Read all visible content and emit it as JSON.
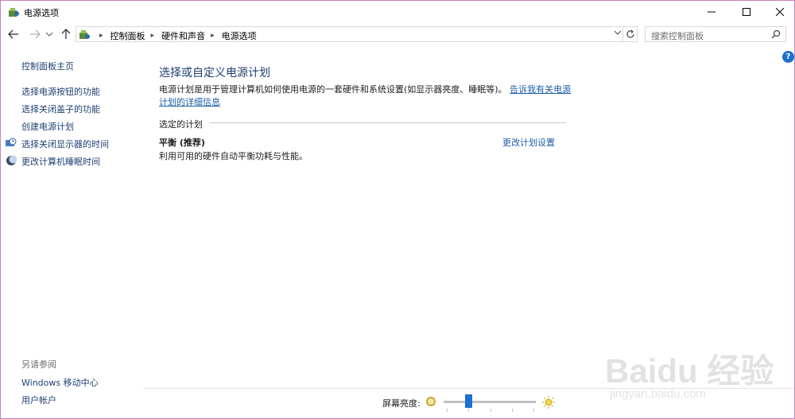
{
  "window": {
    "title": "电源选项"
  },
  "address": {
    "crumbs": [
      "控制面板",
      "硬件和声音",
      "电源选项"
    ],
    "search_placeholder": "搜索控制面板"
  },
  "left": {
    "home": "控制面板主页",
    "links": [
      "选择电源按钮的功能",
      "选择关闭盖子的功能",
      "创建电源计划",
      "选择关闭显示器的时间",
      "更改计算机睡眠时间"
    ],
    "see_also_label": "另请参阅",
    "see_also": [
      "Windows 移动中心",
      "用户帐户"
    ]
  },
  "main": {
    "heading": "选择或自定义电源计划",
    "description": "电源计划是用于管理计算机如何使用电源的一套硬件和系统设置(如显示器亮度、睡眠等)。",
    "learn_more": "告诉我有关电源计划的详细信息",
    "section_label": "选定的计划",
    "plan_name": "平衡 (推荐)",
    "plan_desc": "利用可用的硬件自动平衡功耗与性能。",
    "plan_change": "更改计划设置"
  },
  "brightness": {
    "label": "屏幕亮度:",
    "level": 0.27
  },
  "watermark": {
    "text": "Baidu 经验",
    "sub": "jingyan.baidu.com"
  },
  "colors": {
    "link": "#1d5ea8",
    "heading": "#1f3e6e",
    "accent": "#1d6fd0"
  }
}
